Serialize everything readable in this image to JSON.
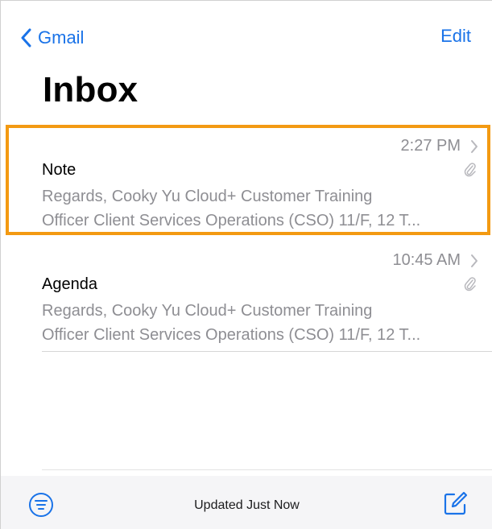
{
  "nav": {
    "back_label": "Gmail",
    "edit_label": "Edit",
    "title": "Inbox"
  },
  "messages": [
    {
      "time": "2:27 PM",
      "subject": "Note",
      "preview_line1": "Regards, Cooky Yu Cloud+ Customer Training",
      "preview_line2": "Officer Client Services Operations (CSO) 11/F, 12 T...",
      "has_attachment": true,
      "highlighted": true
    },
    {
      "time": "10:45 AM",
      "subject": "Agenda",
      "preview_line1": "Regards, Cooky Yu Cloud+ Customer Training",
      "preview_line2": "Officer Client Services Operations (CSO) 11/F, 12 T...",
      "has_attachment": true,
      "highlighted": false
    }
  ],
  "toolbar": {
    "status": "Updated Just Now"
  },
  "colors": {
    "accent": "#1a73e8",
    "highlight": "#f39a12",
    "secondary_text": "#8e8e93"
  },
  "icons": {
    "back": "chevron-left-icon",
    "disclosure": "chevron-right-icon",
    "attachment": "paperclip-icon",
    "filter": "filter-icon",
    "compose": "compose-icon"
  }
}
